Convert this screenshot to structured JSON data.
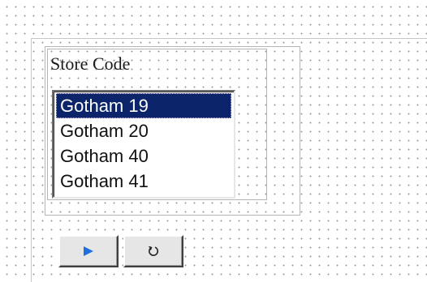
{
  "form": {
    "field_label": "Store Code",
    "listbox": {
      "selected_index": 0,
      "items": [
        {
          "label": "Gotham 19"
        },
        {
          "label": "Gotham 20"
        },
        {
          "label": "Gotham 40"
        },
        {
          "label": "Gotham 41"
        }
      ]
    },
    "buttons": {
      "run_icon": "play-icon",
      "reset_icon": "reset-icon"
    }
  },
  "colors": {
    "selection_background": "#0b246a",
    "play_icon": "#1f6fe0",
    "canvas_dots": "#9a9a9a"
  }
}
